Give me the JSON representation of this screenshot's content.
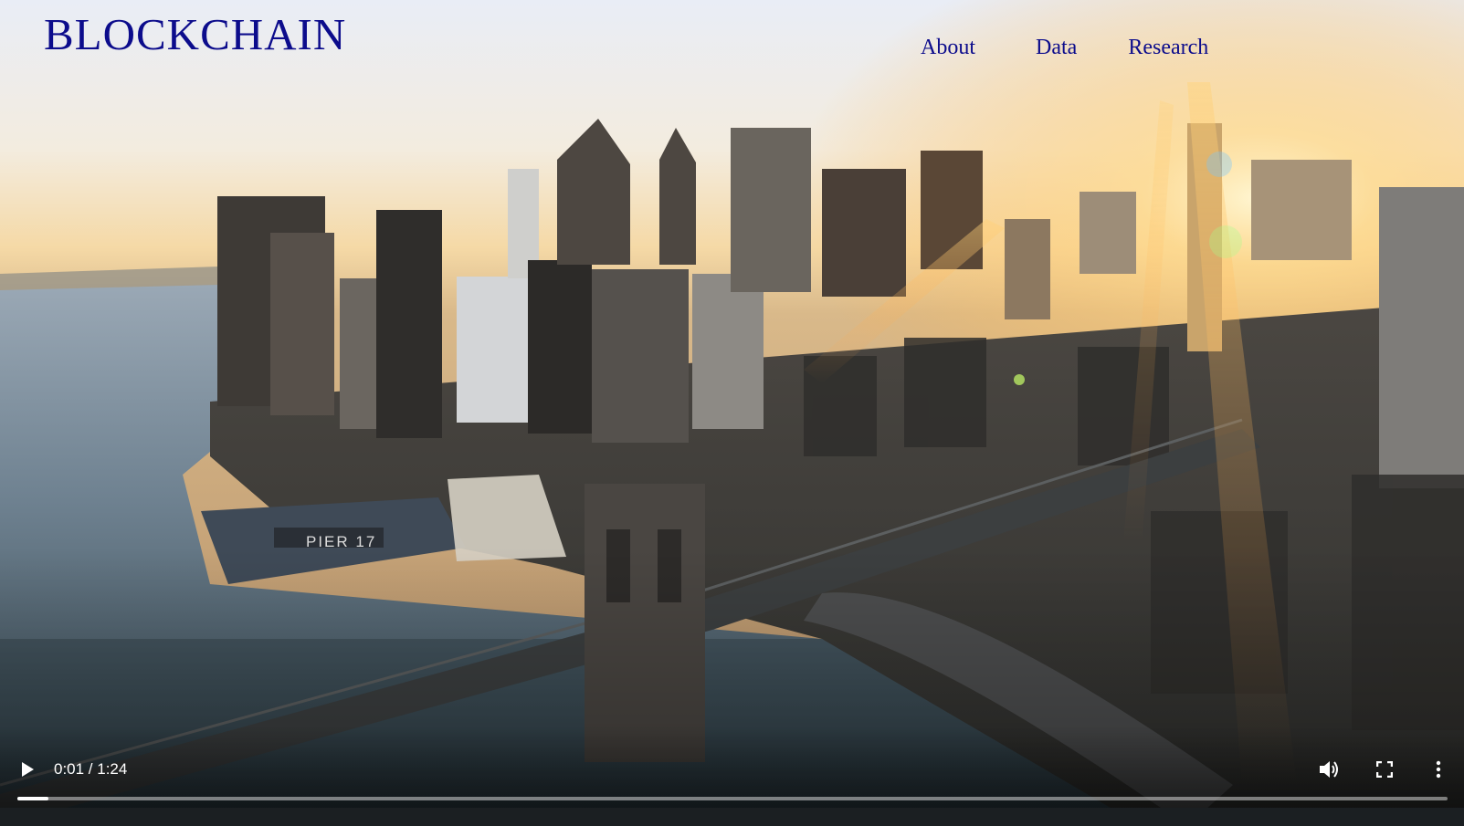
{
  "header": {
    "logo": "BLOCKCHAIN",
    "nav": [
      {
        "label": "About"
      },
      {
        "label": "Data"
      },
      {
        "label": "Research"
      }
    ]
  },
  "video": {
    "scene_icon": "city-skyline-bridge-video-frame",
    "pier_sign": "PIER 17",
    "current_time": "0:01",
    "duration": "1:24",
    "time_display": "0:01 / 1:24",
    "progress_fraction": 0.022,
    "controls": {
      "play_icon": "play-icon",
      "volume_icon": "volume-icon",
      "fullscreen_icon": "fullscreen-icon",
      "more_icon": "more-vertical-icon"
    }
  },
  "colors": {
    "nav_text": "#0c0c8c",
    "controls_text": "#ffffff"
  }
}
